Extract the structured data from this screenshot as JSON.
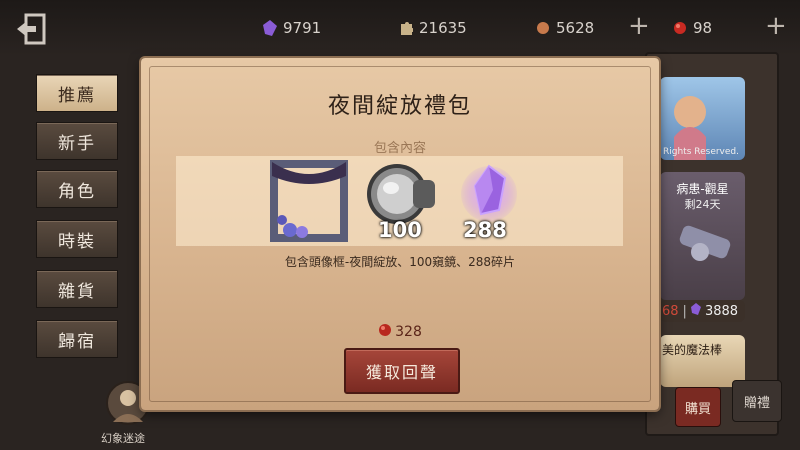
{
  "topbar": {
    "currencies": [
      {
        "icon": "purple-crystal-icon",
        "value": "9791"
      },
      {
        "icon": "puzzle-piece-icon",
        "value": "21635"
      },
      {
        "icon": "bronze-token-icon",
        "value": "5628"
      },
      {
        "icon": "red-echo-icon",
        "value": "98"
      }
    ],
    "plus": "+"
  },
  "sidebar": {
    "items": [
      {
        "label": "推薦"
      },
      {
        "label": "新手"
      },
      {
        "label": "角色"
      },
      {
        "label": "時裝"
      },
      {
        "label": "雜貨"
      },
      {
        "label": "歸宿"
      }
    ]
  },
  "right_cards": {
    "rights_text": "Rights Reserved.",
    "card2_title": "病患-觀星",
    "card2_time": "剩24天",
    "price_row_left": "68",
    "price_row_right": "3888",
    "card3_title": "美的魔法棒",
    "buy_stamp": "購買",
    "gift_stamp": "贈禮"
  },
  "dialog": {
    "title": "夜間綻放禮包",
    "content_label": "包含內容",
    "items": [
      {
        "name": "avatar-frame",
        "qty": ""
      },
      {
        "name": "telescope",
        "qty": "100"
      },
      {
        "name": "crystal-shard",
        "qty": "288"
      }
    ],
    "description": "包含頭像框-夜間綻放、100窺鏡、288碎片",
    "price": "328",
    "buy_button": "獲取回聲"
  },
  "bottom": {
    "label": "幻象迷途"
  },
  "colors": {
    "accent_red": "#8e3328",
    "dialog_bg": "#e0c09b",
    "purple": "#8a5cd6"
  }
}
